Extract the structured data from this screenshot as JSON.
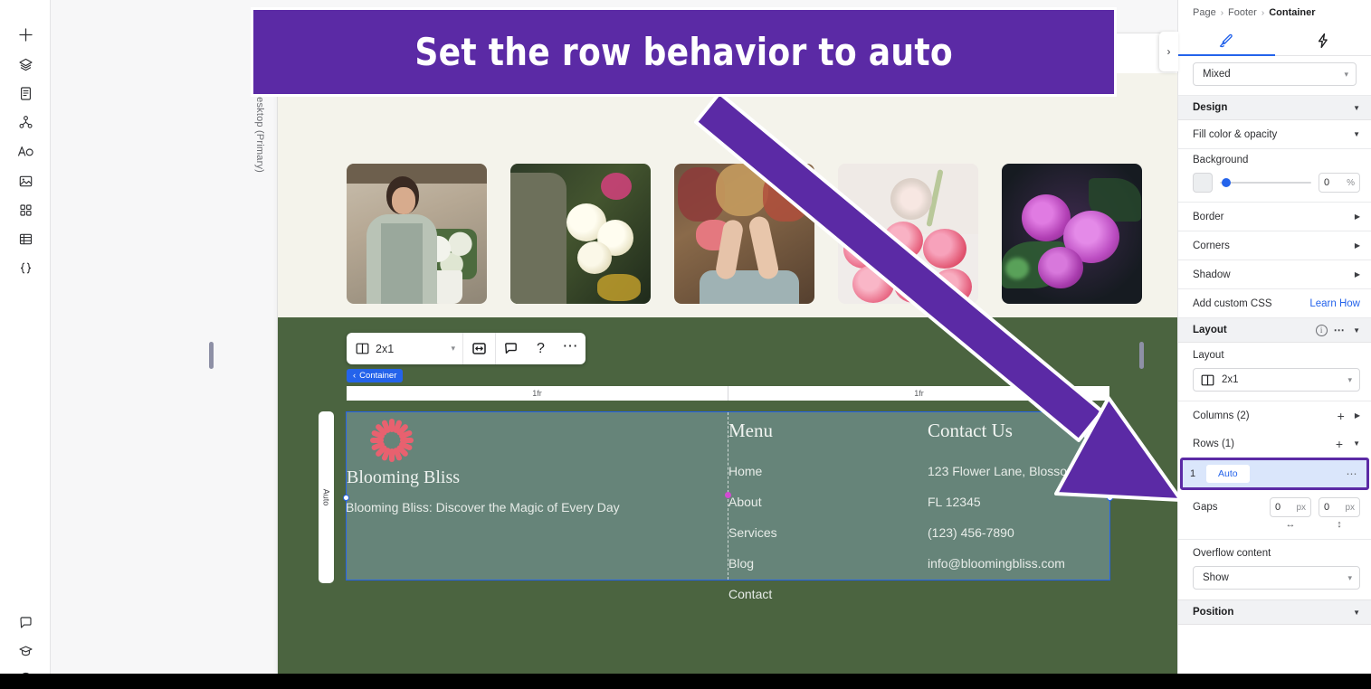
{
  "annotation": {
    "banner_text": "Set the row behavior to auto",
    "accent_color": "#5b2aa5"
  },
  "left_rail": {
    "items": [
      {
        "name": "add-icon",
        "label": "Add"
      },
      {
        "name": "layers-icon",
        "label": "Layers"
      },
      {
        "name": "pages-icon",
        "label": "Pages"
      },
      {
        "name": "site-structure-icon",
        "label": "Site structure"
      },
      {
        "name": "text-styles-icon",
        "label": "Text styles"
      },
      {
        "name": "media-icon",
        "label": "Media"
      },
      {
        "name": "apps-icon",
        "label": "Apps"
      },
      {
        "name": "cms-icon",
        "label": "CMS"
      },
      {
        "name": "dev-mode-icon",
        "label": "Dev mode"
      }
    ],
    "bottom_items": [
      {
        "name": "comments-icon",
        "label": "Comments"
      },
      {
        "name": "learn-icon",
        "label": "Learn"
      },
      {
        "name": "help-icon",
        "label": "Help"
      }
    ]
  },
  "canvas": {
    "viewport_label": "Desktop (Primary)",
    "collapse_label": "›",
    "container_toolbar": {
      "layout_value": "2x1",
      "buttons": [
        "resize-icon",
        "comment-icon",
        "help-icon",
        "more-icon"
      ],
      "help_glyph": "?",
      "more_glyph": "•••"
    },
    "breadcrumb_badge": "Container",
    "breadcrumb_badge_chevron": "‹",
    "column_rulers": [
      "1fr",
      "1fr"
    ],
    "row_ruler_label": "Auto",
    "gallery": [
      {
        "name": "photo-florist-woman"
      },
      {
        "name": "photo-white-roses"
      },
      {
        "name": "photo-dried-flowers"
      },
      {
        "name": "photo-pink-roses"
      },
      {
        "name": "photo-purple-roses"
      }
    ],
    "footer": {
      "brand_name": "Blooming Bliss",
      "tagline": "Blooming Bliss: Discover the Magic of Every Day",
      "menu_heading": "Menu",
      "menu_items": [
        "Home",
        "About",
        "Services",
        "Blog",
        "Contact"
      ],
      "contact_heading": "Contact Us",
      "contact_items": [
        "123 Flower Lane, Blossom City,",
        "FL 12345",
        "(123) 456-7890",
        "info@bloomingbliss.com"
      ]
    }
  },
  "inspector": {
    "breadcrumb": {
      "root": "Page",
      "sep1": "›",
      "middle": "Footer",
      "sep2": "›",
      "current": "Container"
    },
    "tabs": [
      {
        "name": "tab-design",
        "icon": "brush-icon",
        "active": true
      },
      {
        "name": "tab-interactions",
        "icon": "lightning-icon",
        "active": false
      }
    ],
    "selection_select": {
      "value": "Mixed",
      "chevron": "⌄"
    },
    "sections": {
      "design": {
        "title": "Design",
        "collapse_glyph": "▼"
      },
      "fill": {
        "title": "Fill color & opacity",
        "collapse_glyph": "▼",
        "background_label": "Background",
        "opacity_value": "0",
        "opacity_unit": "%"
      },
      "border": {
        "title": "Border",
        "expand_glyph": "▶"
      },
      "corners": {
        "title": "Corners",
        "expand_glyph": "▶"
      },
      "shadow": {
        "title": "Shadow",
        "expand_glyph": "▶"
      },
      "custom_css": {
        "title": "Add custom CSS",
        "link": "Learn How"
      },
      "layout": {
        "title": "Layout",
        "info_glyph": "i",
        "dots_glyph": "•••",
        "collapse_glyph": "▼",
        "field_label": "Layout",
        "field_value": "2x1",
        "field_chevron": "⌄",
        "columns_label": "Columns (2)",
        "columns_plus": "+",
        "columns_tri": "▶",
        "rows_label": "Rows (1)",
        "rows_plus": "+",
        "rows_tri": "▼",
        "row_entry": {
          "index": "1",
          "behavior": "Auto",
          "dots": "•••"
        },
        "gaps_label": "Gaps",
        "gap_h_value": "0",
        "gap_h_unit": "px",
        "gap_v_value": "0",
        "gap_v_unit": "px",
        "gap_h_icon": "↔",
        "gap_v_icon": "↕",
        "overflow_label": "Overflow content",
        "overflow_value": "Show",
        "overflow_chevron": "⌄"
      },
      "position": {
        "title": "Position",
        "collapse_glyph": "▼"
      }
    }
  }
}
